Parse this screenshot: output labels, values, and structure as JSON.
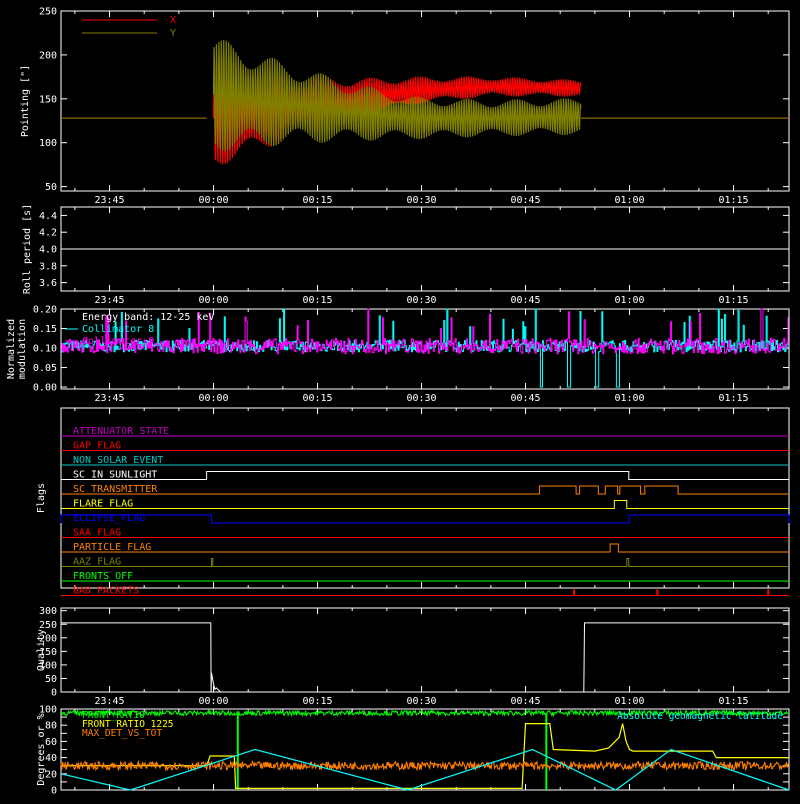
{
  "xaxis": {
    "tick_labels": [
      "23:45",
      "00:00",
      "00:15",
      "00:30",
      "00:45",
      "01:00",
      "01:15"
    ],
    "tick_minutes": [
      -15,
      0,
      15,
      30,
      45,
      60,
      75
    ],
    "range_minutes": [
      -22,
      83
    ]
  },
  "colors": {
    "axis": "#ffffff",
    "red": "#ff0000",
    "olive": "#808000",
    "cyan": "#00ffff",
    "magenta": "#ff00ff",
    "green": "#00ff00",
    "yellow": "#ffff00",
    "orange": "#ff8000",
    "blue": "#0000ff",
    "purple": "#c000c0"
  },
  "chart_data": [
    {
      "id": "pointing",
      "type": "line",
      "ylabel": "Pointing [\"]",
      "ylim": [
        45,
        250
      ],
      "yticks": [
        50,
        100,
        150,
        200,
        250
      ],
      "legend": [
        {
          "name": "X",
          "color": "#ff0000"
        },
        {
          "name": "Y",
          "color": "#808000"
        }
      ],
      "series": [
        {
          "name": "X",
          "color": "#ff0000",
          "x": [
            -1,
            0,
            10,
            20,
            30,
            40,
            53
          ],
          "center": [
            128,
            128,
            140,
            150,
            160,
            164,
            162
          ],
          "amplitude": [
            0,
            60,
            42,
            25,
            16,
            12,
            10
          ],
          "flat_value": 128,
          "active_from": -1,
          "active_to": 53
        },
        {
          "name": "Y",
          "color": "#808000",
          "x": [
            -1,
            0,
            10,
            20,
            30,
            40,
            53
          ],
          "center": [
            128,
            155,
            145,
            135,
            128,
            128,
            130
          ],
          "amplitude": [
            0,
            70,
            50,
            35,
            25,
            22,
            22
          ],
          "flat_value": 128,
          "active_from": -1,
          "active_to": 53
        }
      ]
    },
    {
      "id": "roll",
      "type": "line",
      "ylabel": "Roll period [s]",
      "ylim": [
        3.5,
        4.5
      ],
      "yticks": [
        3.6,
        3.8,
        4.0,
        4.2,
        4.4
      ],
      "ytick_labels": [
        "3.6",
        "3.8",
        "4.0",
        "4.2",
        "4.4"
      ],
      "series": [
        {
          "name": "roll",
          "color": "#ffffff",
          "x": [
            -22,
            83
          ],
          "y": [
            4.0,
            4.0
          ]
        }
      ]
    },
    {
      "id": "modulation",
      "type": "line",
      "ylabel": [
        "Normalized",
        "modulation"
      ],
      "ylim": [
        -0.005,
        0.2
      ],
      "yticks": [
        0.0,
        0.05,
        0.1,
        0.15,
        0.2
      ],
      "ytick_labels": [
        "0.00",
        "0.05",
        "0.10",
        "0.15",
        "0.20"
      ],
      "annotation": "Energy band: 12-25 keV",
      "legend": [
        {
          "name": "Collimator 8",
          "color": "#00ffff"
        },
        {
          "name": "Collimator 9",
          "color": "#ff00ff"
        }
      ],
      "series": [
        {
          "name": "Collimator 8",
          "color": "#00ffff",
          "mean": 0.105,
          "noise": 0.015,
          "dropouts": [
            [
              47,
              48
            ],
            [
              51,
              53
            ],
            [
              55,
              56
            ],
            [
              58,
              59
            ]
          ]
        },
        {
          "name": "Collimator 9",
          "color": "#ff00ff",
          "mean": 0.105,
          "noise": 0.02
        }
      ]
    },
    {
      "id": "flags",
      "type": "line",
      "ylabel": "Flags",
      "flags": [
        {
          "name": "ATTENUATOR_STATE",
          "color": "#c000c0",
          "steps": []
        },
        {
          "name": "GAP_FLAG",
          "color": "#ff0000",
          "steps": []
        },
        {
          "name": "NON_SOLAR_EVENT",
          "color": "#00c8c8",
          "steps": []
        },
        {
          "name": "SC_IN_SUNLIGHT",
          "color": "#ffffff",
          "steps": [
            [
              -1,
              59.9
            ]
          ]
        },
        {
          "name": "SC_TRANSMITTER",
          "color": "#ff8000",
          "steps": [
            [
              47,
              52.3
            ],
            [
              52.8,
              55.5
            ],
            [
              56.5,
              58.3
            ],
            [
              58.6,
              61.6
            ],
            [
              62.2,
              67
            ]
          ]
        },
        {
          "name": "FLARE_FLAG",
          "color": "#ffff00",
          "steps": [
            [
              57.8,
              59.6
            ]
          ]
        },
        {
          "name": "ECLIPSE_FLAG",
          "color": "#0000ff",
          "steps": [
            [
              -22,
              -0.3
            ],
            [
              59.9,
              83
            ]
          ]
        },
        {
          "name": "SAA_FLAG",
          "color": "#ff0000",
          "steps": []
        },
        {
          "name": "PARTICLE_FLAG",
          "color": "#ff8000",
          "steps": [
            [
              57.2,
              58.4
            ]
          ]
        },
        {
          "name": "AAZ_FLAG",
          "color": "#808000",
          "steps": [
            [
              -0.3,
              -0.1
            ],
            [
              59.6,
              59.9
            ]
          ]
        },
        {
          "name": "FRONTS_OFF",
          "color": "#00ff00",
          "steps": []
        },
        {
          "name": "BAD_PACKETS",
          "color": "#ff0000",
          "spikes": [
            52,
            64,
            80
          ]
        }
      ]
    },
    {
      "id": "quality",
      "type": "line",
      "ylabel": "Quality",
      "ylim": [
        0,
        310
      ],
      "yticks": [
        0,
        50,
        100,
        150,
        200,
        250,
        300
      ],
      "series": [
        {
          "name": "quality",
          "color": "#ffffff",
          "x": [
            -22,
            -0.4,
            -0.35,
            -0.3,
            0.0,
            0.2,
            0.4,
            0.8,
            1.0,
            53.4,
            53.5,
            83
          ],
          "y": [
            255,
            255,
            0,
            70,
            30,
            10,
            15,
            5,
            0,
            0,
            255,
            255
          ]
        }
      ]
    },
    {
      "id": "misc",
      "type": "line",
      "ylabel": "Degrees or %",
      "ylim": [
        0,
        100
      ],
      "yticks": [
        0,
        10,
        20,
        30,
        40,
        50,
        60,
        70,
        80,
        90,
        100
      ],
      "ytick_labels": [
        "0",
        "",
        "20",
        "",
        "40",
        "",
        "60",
        "",
        "80",
        "",
        "100"
      ],
      "legend": [
        {
          "name": "FRONT_RATIO",
          "color": "#00ff00"
        },
        {
          "name": "FRONT_RATIO_1225",
          "color": "#ffff00"
        },
        {
          "name": "MAX_DET_VS_TOT",
          "color": "#ff8000"
        }
      ],
      "legend_right": {
        "name": "Absolute geomagnetic latitude",
        "color": "#00ffff"
      },
      "series": [
        {
          "name": "FRONT_RATIO",
          "color": "#00ff00",
          "level": 95,
          "noise": 3,
          "dip_at": [
            3.5,
            48
          ],
          "spike": [
            [
              3.5,
              0
            ],
            [
              48,
              0
            ]
          ]
        },
        {
          "name": "FRONT_RATIO_1225",
          "color": "#ffff00",
          "x": [
            -22,
            -1,
            -0.5,
            3,
            3.2,
            44.5,
            45,
            48.5,
            49,
            55,
            57,
            58.5,
            59,
            59.5,
            60,
            60.5,
            72,
            72.5,
            83
          ],
          "y": [
            30,
            30,
            42,
            42,
            2,
            2,
            82,
            82,
            50,
            48,
            52,
            65,
            82,
            60,
            50,
            48,
            48,
            40,
            40
          ]
        },
        {
          "name": "MAX_DET_VS_TOT",
          "color": "#ff8000",
          "level": 30,
          "noise": 5
        },
        {
          "name": "Absolute geomagnetic latitude",
          "color": "#00ffff",
          "x": [
            -22,
            -12,
            6,
            28,
            46,
            58,
            66,
            83
          ],
          "y": [
            20,
            0,
            50,
            0,
            50,
            0,
            50,
            0
          ]
        }
      ]
    }
  ]
}
